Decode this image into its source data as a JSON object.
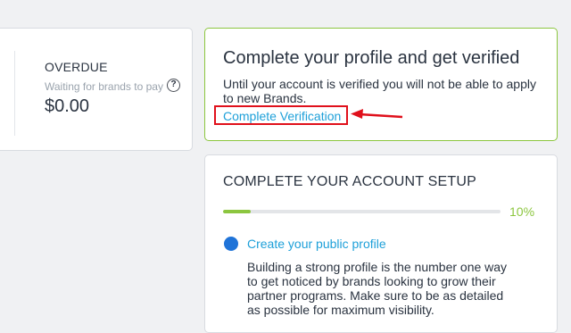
{
  "earnings": {
    "overdue_title": "OVERDUE",
    "overdue_subtitle": "Waiting for brands to pay",
    "help_glyph": "?",
    "overdue_amount": "$0.00"
  },
  "verification": {
    "title": "Complete your profile and get verified",
    "description": "Until your account is verified you will not be able to apply to new Brands.",
    "link_label": "Complete Verification",
    "accent_color": "#8cc63f",
    "highlight_color": "#e0101b"
  },
  "account_setup": {
    "title": "COMPLETE YOUR ACCOUNT SETUP",
    "progress_label": "10%",
    "progress_fraction": 0.1,
    "step": {
      "icon": "blue-circle-icon",
      "label": "Create your public profile",
      "description": "Building a strong profile is the number one way to get noticed by brands looking to grow their partner programs. Make sure to be as detailed as possible for maximum visibility."
    }
  }
}
